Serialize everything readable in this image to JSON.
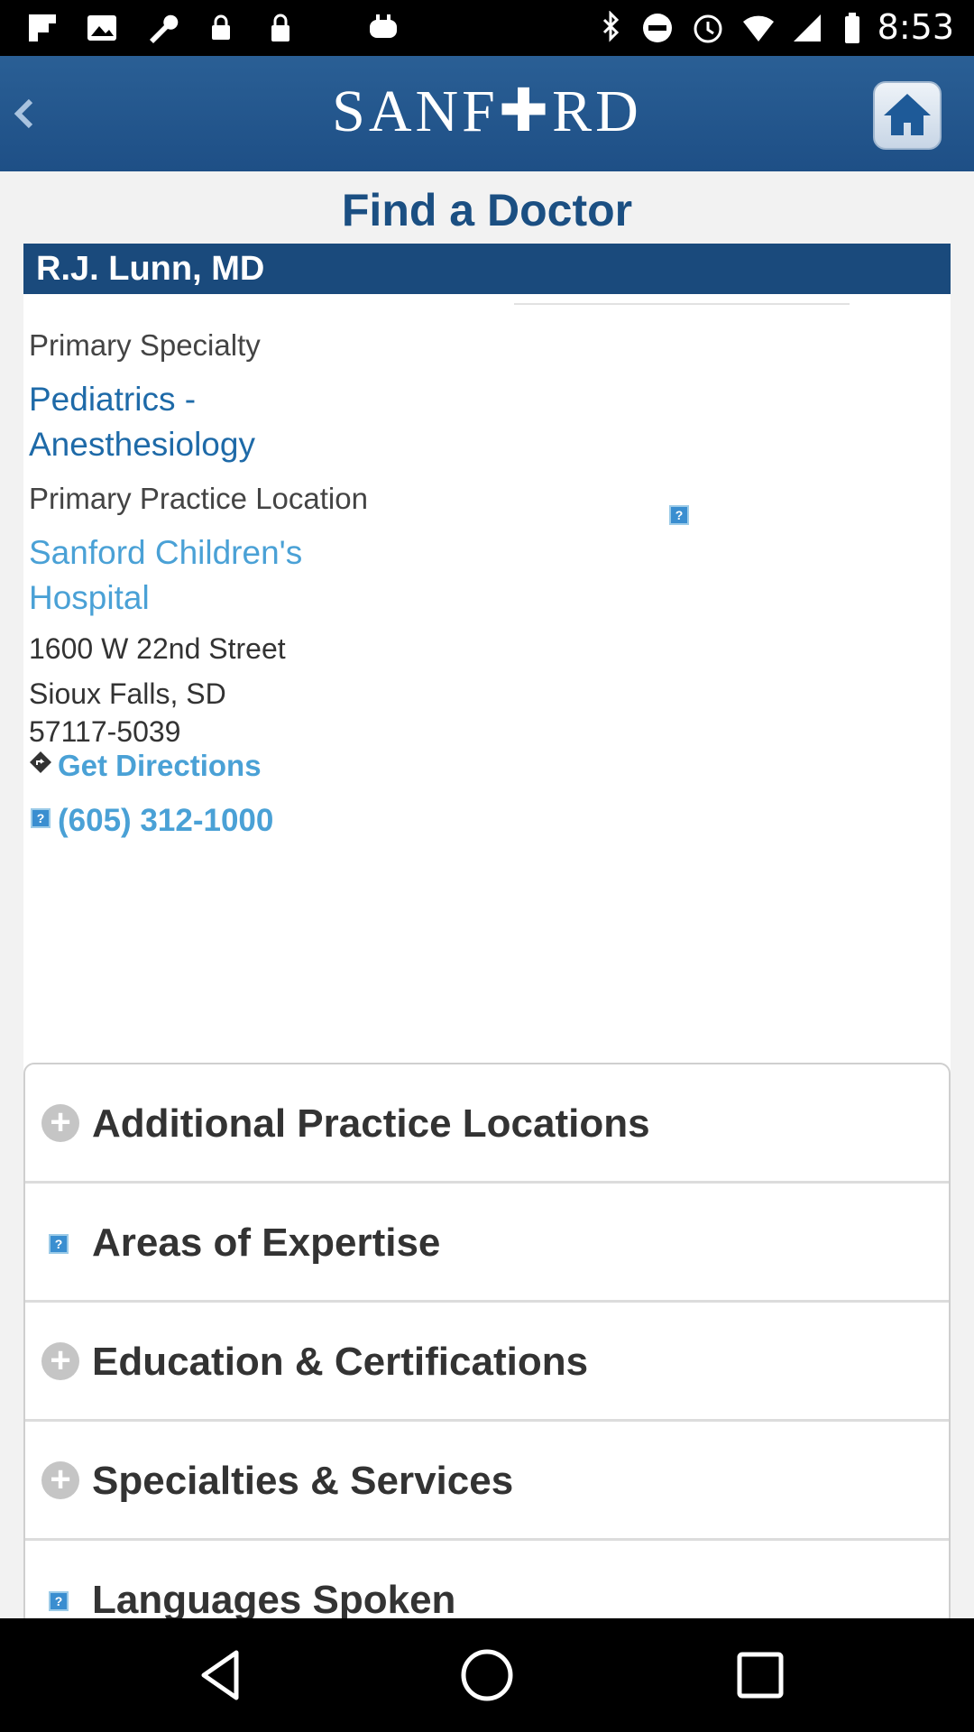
{
  "status_bar": {
    "time": "8:53",
    "icons": [
      "flipboard-icon",
      "image-icon",
      "wrench-icon",
      "lock-icon",
      "gamepad-icon",
      "bluetooth-icon",
      "minus-circle-icon",
      "alarm-icon",
      "wifi-icon",
      "signal-icon",
      "battery-icon"
    ]
  },
  "header": {
    "logo": "SANF✚RD"
  },
  "page": {
    "title": "Find a Doctor"
  },
  "doctor": {
    "name": "R.J. Lunn, MD",
    "primary_specialty_label": "Primary Specialty",
    "specialty_line1": "Pediatrics -",
    "specialty_line2": "Anesthesiology",
    "location_label": "Primary Practice Location",
    "hospital_line1": "Sanford Children's",
    "hospital_line2": "Hospital",
    "street": "1600 W 22nd Street",
    "city_line1": "Sioux Falls, SD",
    "city_line2": "57117-5039",
    "directions": "Get Directions",
    "phone": "(605) 312-1000"
  },
  "accordion": [
    {
      "label": "Additional Practice Locations",
      "icon": "plus-icon"
    },
    {
      "label": "Areas of Expertise",
      "icon": "broken-image-icon"
    },
    {
      "label": "Education & Certifications",
      "icon": "plus-icon"
    },
    {
      "label": "Specialties & Services",
      "icon": "plus-icon"
    },
    {
      "label": "Languages Spoken",
      "icon": "broken-image-icon"
    }
  ],
  "colors": {
    "header": "#1e4f86",
    "title": "#1b4f82",
    "name_bar": "#1a4a7c",
    "link": "#4aa1d6"
  }
}
